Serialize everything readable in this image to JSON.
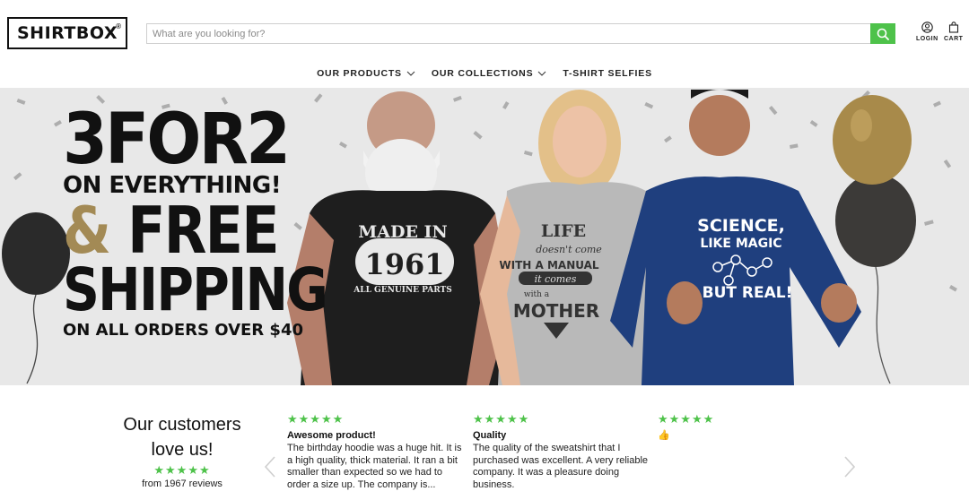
{
  "header": {
    "logo_text": "SHIRTBOX",
    "logo_mark": "®",
    "search": {
      "placeholder": "What are you looking for?",
      "value": ""
    },
    "login_label": "LOGIN",
    "cart_label": "CART",
    "accent_color": "#4ec24a"
  },
  "nav": {
    "items": [
      {
        "label": "OUR PRODUCTS",
        "has_dropdown": true
      },
      {
        "label": "OUR COLLECTIONS",
        "has_dropdown": true
      },
      {
        "label": "T-SHIRT SELFIES",
        "has_dropdown": false
      }
    ]
  },
  "hero": {
    "line1": "3FOR2",
    "line2": "ON EVERYTHING!",
    "line3_amp": "&",
    "line3": " FREE",
    "line4": "SHIPPING",
    "line5": "ON ALL ORDERS OVER $40",
    "shirt1_line1": "MADE IN",
    "shirt1_year": "1961",
    "shirt1_line2": "ALL GENUINE PARTS",
    "shirt2_line1": "LIFE",
    "shirt2_line2": "doesn't come",
    "shirt2_line3": "WITH A MANUAL",
    "shirt2_line4": "it comes",
    "shirt2_line5": "with a",
    "shirt2_line6": "MOTHER",
    "shirt3_line1": "SCIENCE,",
    "shirt3_line2": "LIKE MAGIC",
    "shirt3_line3": "BUT REAL!"
  },
  "reviews": {
    "heading_line1": "Our customers",
    "heading_line2": "love us!",
    "stars": "★★★★★",
    "count_text": "from 1967 reviews",
    "cards": [
      {
        "stars": "★★★★★",
        "title": "Awesome product!",
        "body": "The birthday hoodie was a huge hit. It is a high quality, thick material. It ran a bit smaller than expected so we had to order a size up. The company is..."
      },
      {
        "stars": "★★★★★",
        "title": "Quality",
        "body": "The quality of the sweatshirt that I purchased was excellent. A very reliable company. It was a pleasure doing business."
      },
      {
        "stars": "★★★★★",
        "title": "",
        "body": "👍"
      }
    ]
  }
}
